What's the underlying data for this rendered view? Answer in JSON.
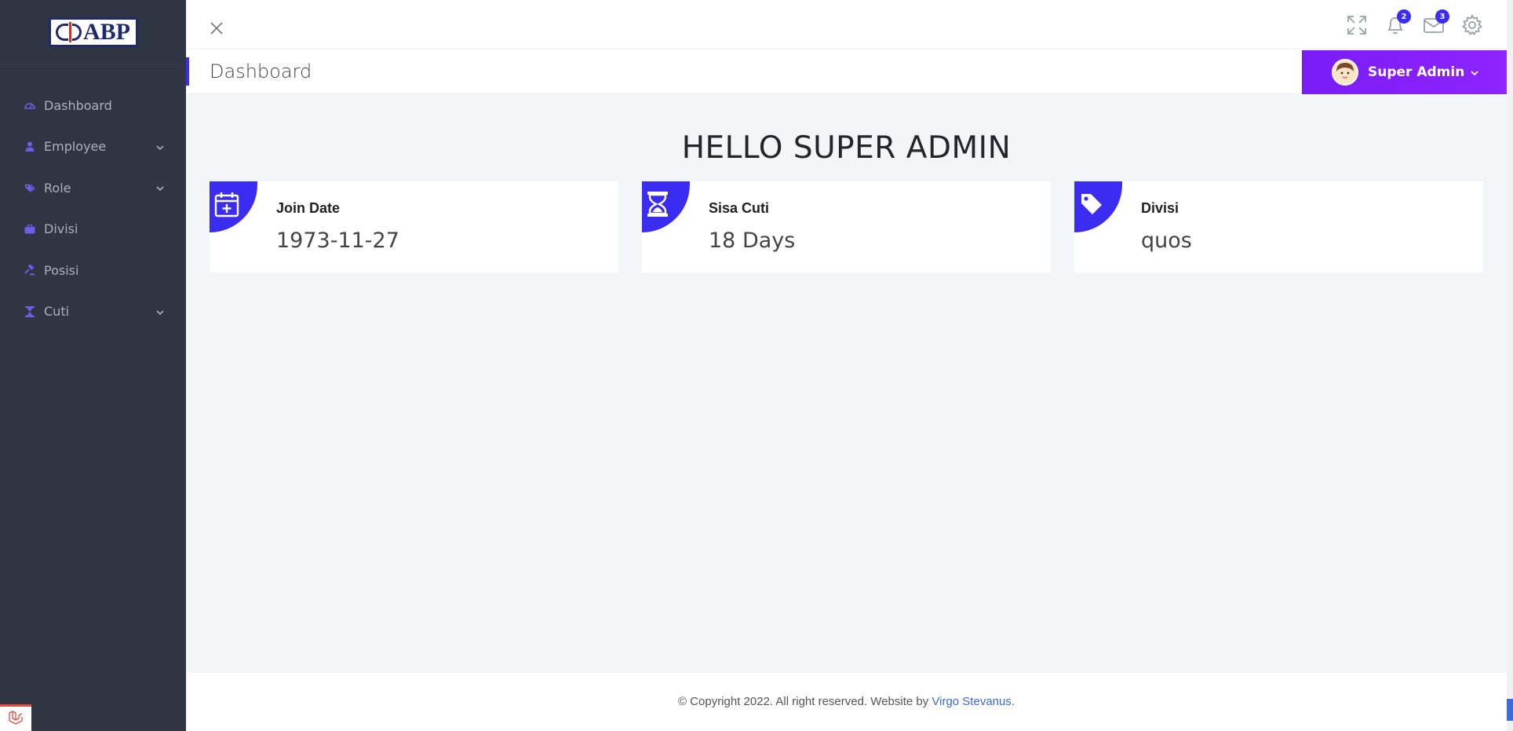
{
  "brand": {
    "logo_text": "ABP"
  },
  "sidebar": {
    "items": [
      {
        "label": "Dashboard",
        "icon": "dashboard-icon",
        "has_submenu": false
      },
      {
        "label": "Employee",
        "icon": "user-icon",
        "has_submenu": true
      },
      {
        "label": "Role",
        "icon": "tags-icon",
        "has_submenu": true
      },
      {
        "label": "Divisi",
        "icon": "briefcase-icon",
        "has_submenu": false
      },
      {
        "label": "Posisi",
        "icon": "gavel-icon",
        "has_submenu": false
      },
      {
        "label": "Cuti",
        "icon": "hourglass-icon",
        "has_submenu": true
      }
    ]
  },
  "header": {
    "notifications_count": "2",
    "messages_count": "3",
    "page_title": "Dashboard",
    "user_name": "Super Admin"
  },
  "main": {
    "greeting": "HELLO SUPER ADMIN",
    "cards": [
      {
        "label": "Join Date",
        "value": "1973-11-27",
        "icon": "calendar-plus-icon"
      },
      {
        "label": "Sisa Cuti",
        "value": "18 Days",
        "icon": "hourglass-icon"
      },
      {
        "label": "Divisi",
        "value": "quos",
        "icon": "tag-icon"
      }
    ]
  },
  "footer": {
    "text": "© Copyright 2022. All right reserved. Website by ",
    "author": "Virgo Stevanus",
    "suffix": "."
  },
  "colors": {
    "accent": "#3a2cf1",
    "sidebar_bg": "#2f3542",
    "user_button": "#8a22fb",
    "main_bg": "#f2f6f9"
  }
}
